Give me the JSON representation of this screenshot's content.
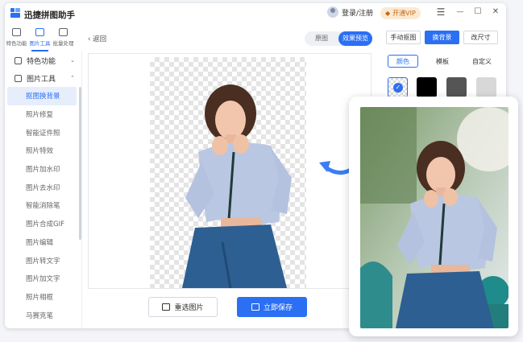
{
  "app": {
    "title": "迅捷拼图助手"
  },
  "header": {
    "login_label": "登录/注册",
    "vip_label": "开通VIP"
  },
  "window_controls": {
    "menu": "☰",
    "minimize": "—",
    "maximize": "☐",
    "close": "✕"
  },
  "top_icons": [
    {
      "label": "特色功能"
    },
    {
      "label": "图片工具"
    },
    {
      "label": "批量处理"
    }
  ],
  "sidebar": {
    "sections": [
      {
        "label": "特色功能",
        "chevron": "⌄"
      },
      {
        "label": "图片工具",
        "chevron": "⌃"
      }
    ],
    "items": [
      {
        "label": "抠图换背景"
      },
      {
        "label": "照片修复"
      },
      {
        "label": "智能证件照"
      },
      {
        "label": "照片特效"
      },
      {
        "label": "图片加水印"
      },
      {
        "label": "图片去水印"
      },
      {
        "label": "智能消除笔"
      },
      {
        "label": "图片合成GIF"
      },
      {
        "label": "图片编辑"
      },
      {
        "label": "图片转文字"
      },
      {
        "label": "图片加文字"
      },
      {
        "label": "照片相框"
      },
      {
        "label": "马赛克笔"
      }
    ]
  },
  "main": {
    "back_label": "返回",
    "view_toggle": {
      "original": "原图",
      "preview": "效果预览"
    },
    "reselect_label": "重选图片",
    "save_label": "立即保存"
  },
  "right_panel": {
    "tabs": [
      {
        "label": "手动抠图"
      },
      {
        "label": "换背景"
      },
      {
        "label": "改尺寸"
      }
    ],
    "subtabs": [
      {
        "label": "颜色"
      },
      {
        "label": "模板"
      },
      {
        "label": "自定义"
      }
    ],
    "swatches": [
      "transparent",
      "#000000",
      "#555555",
      "#d8d8d8"
    ]
  },
  "colors": {
    "accent": "#2b6ff3",
    "vip_bg": "#fbe9d1",
    "vip_text": "#c06b15"
  }
}
